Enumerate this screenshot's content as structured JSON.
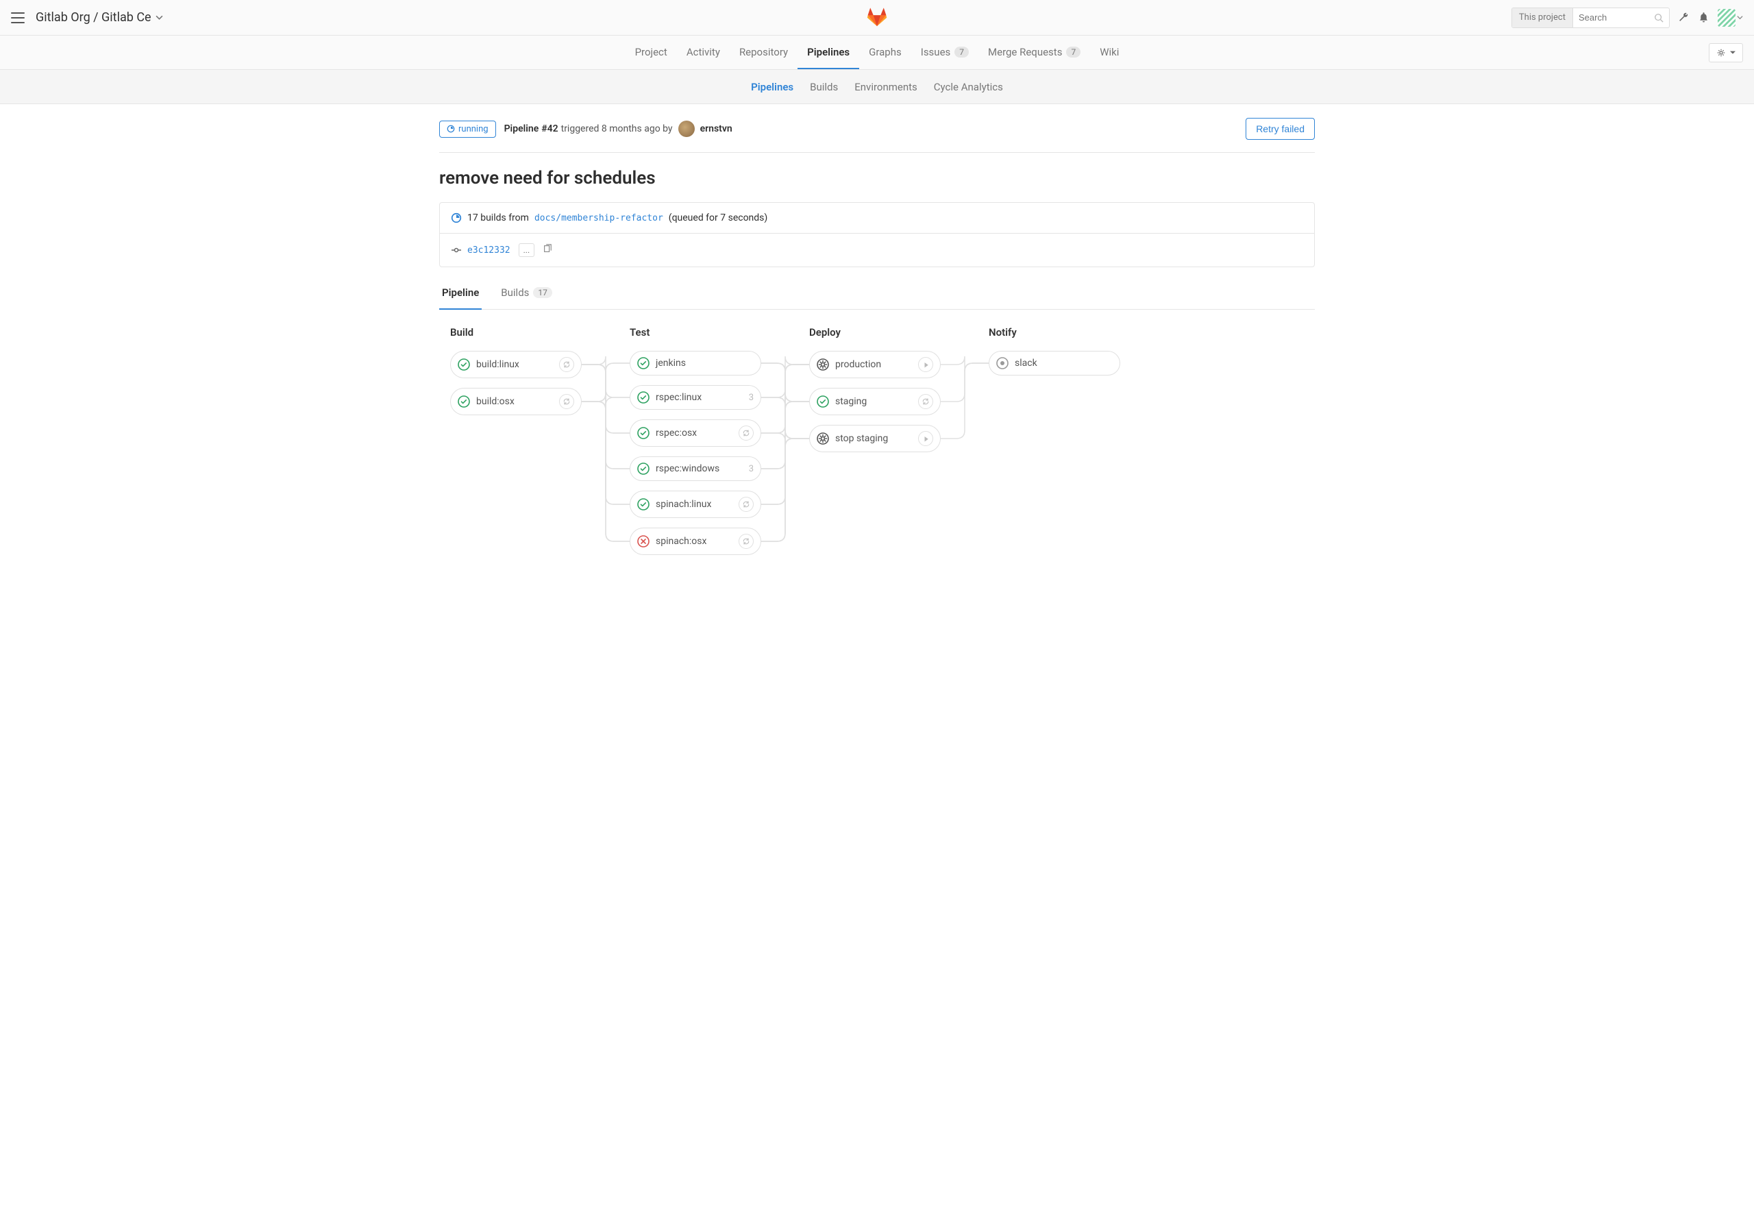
{
  "breadcrumb": "Gitlab Org / Gitlab Ce",
  "search": {
    "scope": "This project",
    "placeholder": "Search"
  },
  "nav": {
    "project": "Project",
    "activity": "Activity",
    "repository": "Repository",
    "pipelines": "Pipelines",
    "graphs": "Graphs",
    "issues": "Issues",
    "issues_count": "7",
    "merge_requests": "Merge Requests",
    "mr_count": "7",
    "wiki": "Wiki"
  },
  "subnav": {
    "pipelines": "Pipelines",
    "builds": "Builds",
    "environments": "Environments",
    "cycle": "Cycle Analytics"
  },
  "status": {
    "label": "running"
  },
  "pipeline": {
    "prefix": "Pipeline",
    "number": "#42",
    "triggered": "triggered 8 months ago by",
    "user": "ernstvn"
  },
  "retry_label": "Retry failed",
  "title": "remove need for schedules",
  "builds_from": {
    "count_text": "17 builds from",
    "branch": "docs/membership-refactor",
    "queued": "(queued for 7 seconds)"
  },
  "commit": {
    "sha": "e3c12332",
    "ellipsis": "..."
  },
  "detail_tabs": {
    "pipeline": "Pipeline",
    "builds": "Builds",
    "builds_count": "17"
  },
  "stages": {
    "build": {
      "title": "Build",
      "jobs": [
        {
          "name": "build:linux",
          "status": "passed",
          "action": "retry"
        },
        {
          "name": "build:osx",
          "status": "passed",
          "action": "retry"
        }
      ]
    },
    "test": {
      "title": "Test",
      "jobs": [
        {
          "name": "jenkins",
          "status": "passed"
        },
        {
          "name": "rspec:linux",
          "status": "passed",
          "count": "3"
        },
        {
          "name": "rspec:osx",
          "status": "passed",
          "action": "retry"
        },
        {
          "name": "rspec:windows",
          "status": "passed",
          "count": "3"
        },
        {
          "name": "spinach:linux",
          "status": "passed",
          "action": "retry"
        },
        {
          "name": "spinach:osx",
          "status": "failed",
          "action": "retry"
        }
      ]
    },
    "deploy": {
      "title": "Deploy",
      "jobs": [
        {
          "name": "production",
          "status": "manual",
          "action": "play"
        },
        {
          "name": "staging",
          "status": "passed",
          "action": "retry"
        },
        {
          "name": "stop staging",
          "status": "manual",
          "action": "play"
        }
      ]
    },
    "notify": {
      "title": "Notify",
      "jobs": [
        {
          "name": "slack",
          "status": "skipped"
        }
      ]
    }
  }
}
